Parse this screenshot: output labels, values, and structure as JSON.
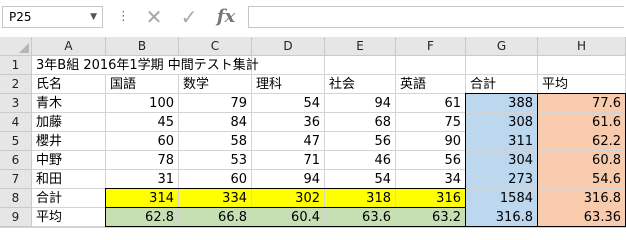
{
  "name_box": {
    "value": "P25"
  },
  "formula_bar": {
    "value": "",
    "fx_label": "fx"
  },
  "colors": {
    "yellow": "#ffff00",
    "green": "#c6e0b4",
    "blue": "#bdd7ee",
    "orange": "#f8cbad"
  },
  "columns": [
    "A",
    "B",
    "C",
    "D",
    "E",
    "F",
    "G",
    "H"
  ],
  "rows": [
    "1",
    "2",
    "3",
    "4",
    "5",
    "6",
    "7",
    "8",
    "9"
  ],
  "sheet": {
    "title": "3年B組 2016年1学期 中間テスト集計",
    "headers": [
      "氏名",
      "国語",
      "数学",
      "理科",
      "社会",
      "英語",
      "合計",
      "平均"
    ],
    "students": [
      {
        "name": "青木",
        "scores": [
          "100",
          "79",
          "54",
          "94",
          "61"
        ],
        "total": "388",
        "avg": "77.6"
      },
      {
        "name": "加藤",
        "scores": [
          "45",
          "84",
          "36",
          "68",
          "75"
        ],
        "total": "308",
        "avg": "61.6"
      },
      {
        "name": "櫻井",
        "scores": [
          "60",
          "58",
          "47",
          "56",
          "90"
        ],
        "total": "311",
        "avg": "62.2"
      },
      {
        "name": "中野",
        "scores": [
          "78",
          "53",
          "71",
          "46",
          "56"
        ],
        "total": "304",
        "avg": "60.8"
      },
      {
        "name": "和田",
        "scores": [
          "31",
          "60",
          "94",
          "54",
          "34"
        ],
        "total": "273",
        "avg": "54.6"
      }
    ],
    "total_row": {
      "label": "合計",
      "values": [
        "314",
        "334",
        "302",
        "318",
        "316"
      ],
      "total": "1584",
      "avg": "316.8"
    },
    "avg_row": {
      "label": "平均",
      "values": [
        "62.8",
        "66.8",
        "60.4",
        "63.6",
        "63.2"
      ],
      "total": "316.8",
      "avg": "63.36"
    }
  }
}
